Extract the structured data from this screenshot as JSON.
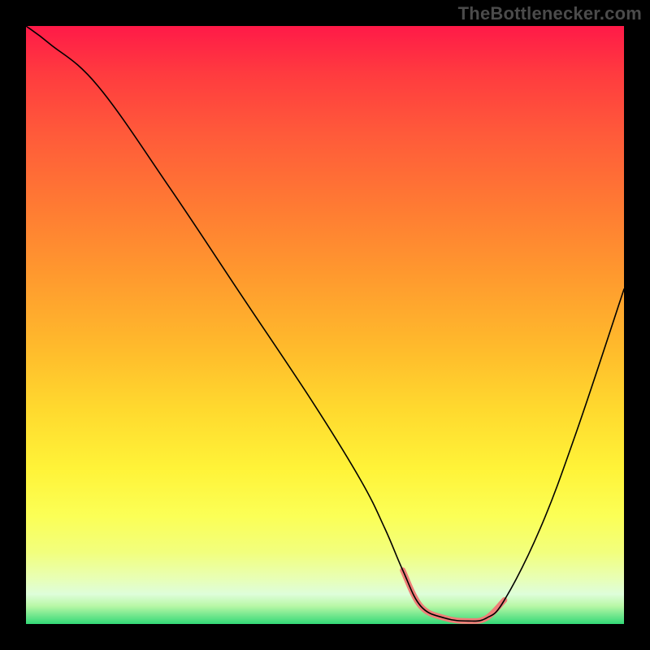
{
  "watermark": "TheBottlenecker.com",
  "chart_data": {
    "type": "line",
    "title": "",
    "xlabel": "",
    "ylabel": "",
    "xlim": [
      0,
      100
    ],
    "ylim": [
      0,
      100
    ],
    "series": [
      {
        "name": "curve",
        "x": [
          0,
          4,
          12,
          24,
          36,
          48,
          56,
          60,
          63,
          66,
          70,
          74,
          77,
          80,
          86,
          92,
          100
        ],
        "values": [
          100,
          97,
          90,
          73,
          55,
          37,
          24,
          16,
          9,
          3,
          1,
          0.5,
          1,
          4,
          16,
          32,
          56
        ]
      }
    ],
    "highlight_range_x": [
      63,
      80
    ],
    "colors": {
      "curve": "#000000",
      "highlight": "#ef7e78",
      "gradient_top": "#ff1a48",
      "gradient_bottom": "#33d977",
      "frame": "#000000"
    }
  }
}
